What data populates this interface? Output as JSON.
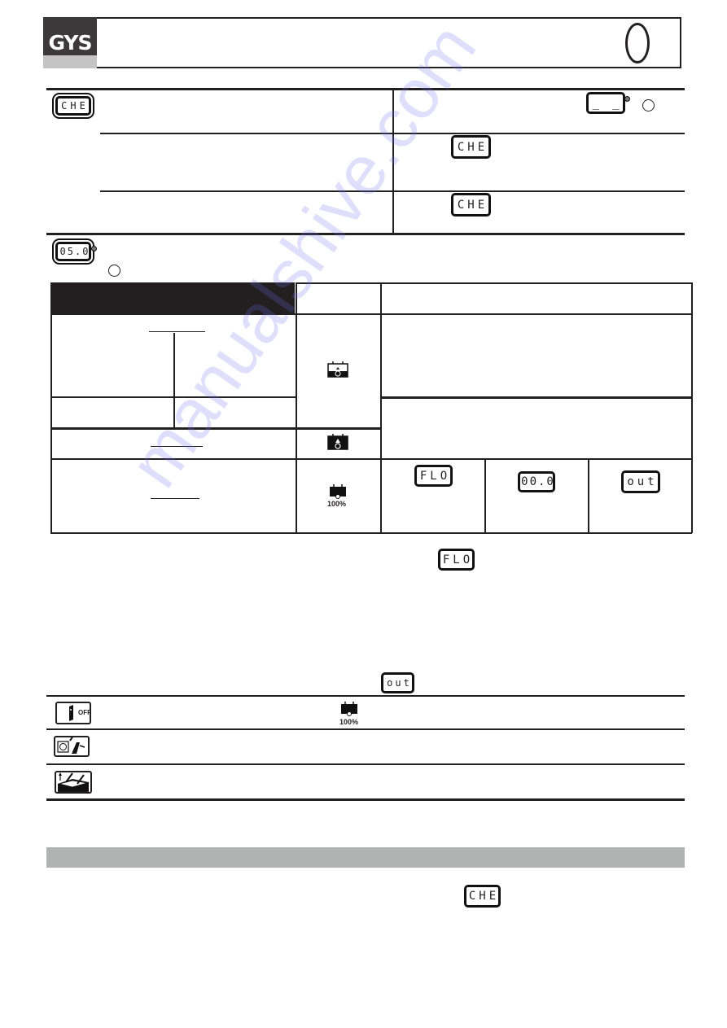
{
  "header": {
    "brand": "GYS",
    "language_marker": "",
    "colors": {
      "logo_dark": "#3d393a",
      "logo_light": "#c4c4c4",
      "section_bar": "#b1b2b2",
      "ink": "#231f20"
    }
  },
  "check_section": {
    "icon_display": "CHE",
    "rows": [
      {
        "right_display": "_ _",
        "right_indicator": "led-circle"
      },
      {
        "right_display": "CHE"
      },
      {
        "right_display": "CHE"
      }
    ]
  },
  "current_section": {
    "icon_display": "05.0"
  },
  "charge_table": {
    "battery_icons": [
      "battery-charging-icon",
      "battery-charging-full-icon",
      "battery-100-icon"
    ],
    "battery_100_label": "100%",
    "end_displays": [
      "FLO",
      "00.0",
      "out"
    ]
  },
  "body_displays": {
    "float_display": "FLO",
    "out_display": "out"
  },
  "end_steps": {
    "off_label": "OFF",
    "battery_label": "100%",
    "steps": [
      "switch-off-icon",
      "unplug-icon",
      "disconnect-clamps-icon"
    ]
  },
  "section2": {
    "display": "CHE"
  },
  "watermark": "manualshive.com"
}
